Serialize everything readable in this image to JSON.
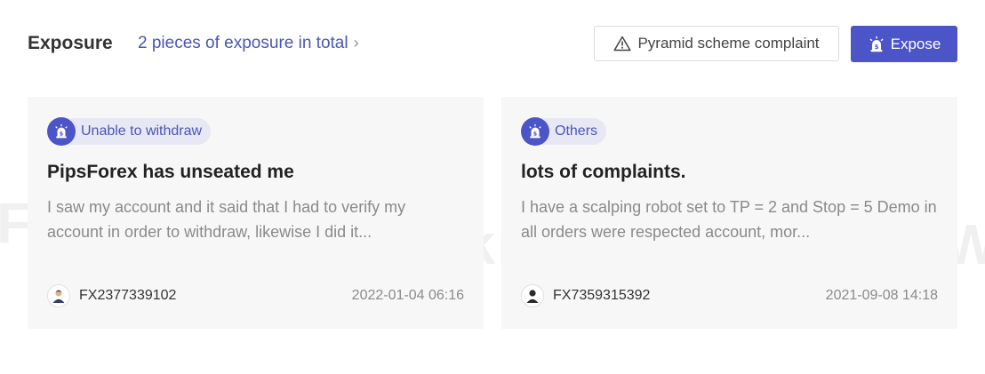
{
  "header": {
    "title": "Exposure",
    "total_link": "2 pieces of exposure in total",
    "complaint_button": "Pyramid scheme complaint",
    "expose_button": "Expose"
  },
  "colors": {
    "accent": "#4b55c8",
    "tag_bg": "#e7e8f4",
    "card_bg": "#f7f7f8"
  },
  "cards": [
    {
      "tag": "Unable to withdraw",
      "title": "PipsForex has unseated me",
      "body": "I saw my account and it said that I had to verify my account in order to withdraw, likewise I did it...",
      "user": "FX2377339102",
      "date": "2022-01-04 06:16"
    },
    {
      "tag": "Others",
      "title": "lots of complaints.",
      "body": "I have a scalping robot set to TP = 2 and Stop = 5 Demo in all orders were respected account, mor...",
      "user": "FX7359315392",
      "date": "2021-09-08 14:18"
    }
  ],
  "watermarks": [
    "FX",
    "WikiFX",
    "W"
  ]
}
